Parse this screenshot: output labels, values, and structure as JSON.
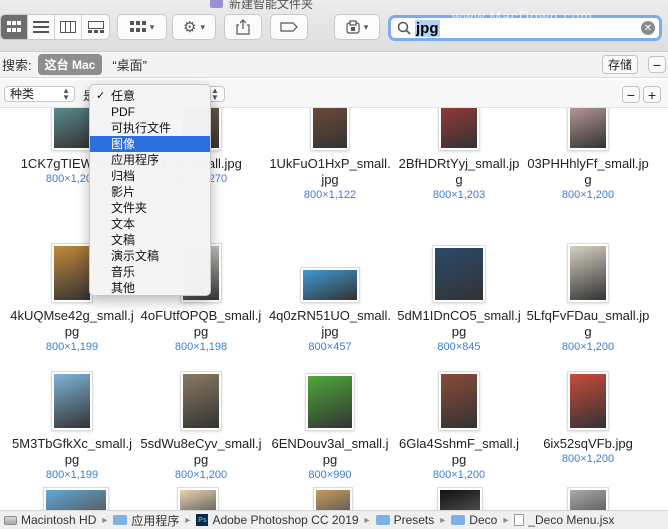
{
  "window": {
    "title": "新建智能文件夹"
  },
  "toolbar": {
    "view_buttons": [
      "icon-view",
      "list-view",
      "column-view",
      "gallery-view"
    ],
    "active_view": "icon-view",
    "search": {
      "value": "jpg",
      "clear_icon": "clear-icon"
    },
    "watermark": "www.MacDown.com"
  },
  "scope": {
    "label": "搜索:",
    "this_mac": "这台 Mac",
    "desktop": "“桌面”",
    "save": "存储"
  },
  "criteria": {
    "attribute": "种类",
    "operator": "是",
    "minus": "−",
    "plus": "+"
  },
  "kind_menu": {
    "checked_index": 0,
    "selected_index": 3,
    "items": [
      "任意",
      "PDF",
      "可执行文件",
      "图像",
      "应用程序",
      "归档",
      "影片",
      "文件夹",
      "文本",
      "文稿",
      "演示文稿",
      "音乐",
      "其他"
    ]
  },
  "files": [
    {
      "name": "1CK7gTIEWxl.jpg",
      "dims": "800×1,200",
      "color": "#5a8a8e"
    },
    {
      "name": "1_A_small.jpg",
      "dims": "800×1,270",
      "color": "#8a6a48"
    },
    {
      "name": "1UkFuO1HxP_small.jpg",
      "dims": "800×1,122",
      "color": "#6b4a3a"
    },
    {
      "name": "2BfHDRtYyj_small.jpg",
      "dims": "800×1,203",
      "color": "#b03a3a"
    },
    {
      "name": "03PHHhlyFf_small.jpg",
      "dims": "800×1,200",
      "color": "#d8b4b0"
    },
    {
      "name": "4kUQMse42g_small.jpg",
      "dims": "800×1,199",
      "color": "#c4883a"
    },
    {
      "name": "4oFUtfOPQB_small.jpg",
      "dims": "800×1,198",
      "color": "#e0ddd6"
    },
    {
      "name": "4q0zRN51UO_small.jpg",
      "dims": "800×457",
      "color": "#3d9bd4"
    },
    {
      "name": "5dM1IDnCO5_small.jpg",
      "dims": "800×845",
      "color": "#2a4a6a"
    },
    {
      "name": "5LfqFvFDau_small.jpg",
      "dims": "800×1,200",
      "color": "#d6d0c0"
    },
    {
      "name": "5M3TbGfkXc_small.jpg",
      "dims": "800×1,199",
      "color": "#7fb4d8"
    },
    {
      "name": "5sdWu8eCyv_small.jpg",
      "dims": "800×1,200",
      "color": "#8a7a62"
    },
    {
      "name": "6ENDouv3al_small.jpg",
      "dims": "800×990",
      "color": "#4ea83a"
    },
    {
      "name": "6Gla4SshmF_small.jpg",
      "dims": "800×1,200",
      "color": "#8a4a3a"
    },
    {
      "name": "6ix52sqVFb.jpg",
      "dims": "800×1,200",
      "color": "#c84a3a"
    }
  ],
  "pathbar": {
    "crumbs": [
      "Macintosh HD",
      "应用程序",
      "Adobe Photoshop CC 2019",
      "Presets",
      "Deco",
      "_Deco Menu.jsx"
    ],
    "icons": [
      "hd-icon",
      "folder-icon",
      "photoshop-icon",
      "folder-icon",
      "folder-icon",
      "file-icon"
    ]
  }
}
